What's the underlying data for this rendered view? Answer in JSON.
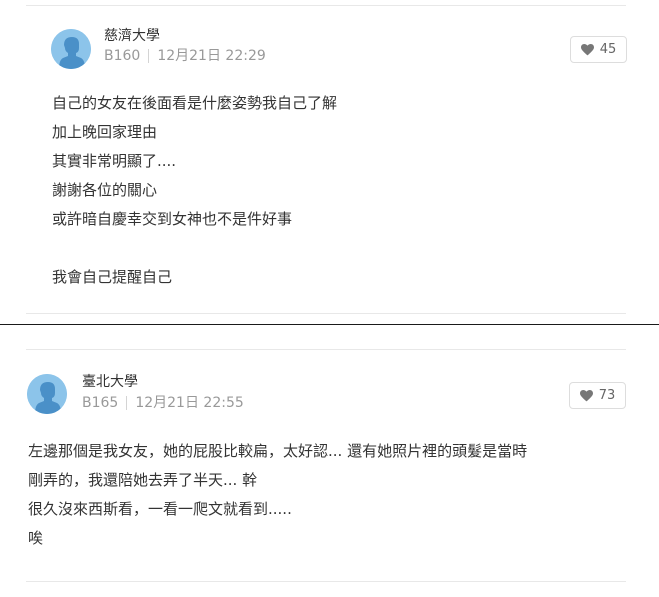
{
  "comments": [
    {
      "school": "慈濟大學",
      "floor": "B160",
      "time": "12月21日 22:29",
      "likes": "45",
      "lines": [
        "自己的女友在後面看是什麼姿勢我自己了解",
        "加上晚回家理由",
        "其實非常明顯了....",
        "謝謝各位的關心",
        "或許暗自慶幸交到女神也不是件好事",
        "",
        "我會自己提醒自己"
      ]
    },
    {
      "school": "臺北大學",
      "floor": "B165",
      "time": "12月21日 22:55",
      "likes": "73",
      "lines": [
        "左邊那個是我女友，她的屁股比較扁，太好認... 還有她照片裡的頭髮是當時",
        "剛弄的，我還陪她去弄了半天... 幹",
        "很久沒來西斯看，一看一爬文就看到.....",
        "唉"
      ]
    }
  ],
  "colors": {
    "avatar": "#8cc4ea",
    "avatar_figure": "#4a90c8",
    "text": "#333333",
    "meta": "#999999"
  }
}
